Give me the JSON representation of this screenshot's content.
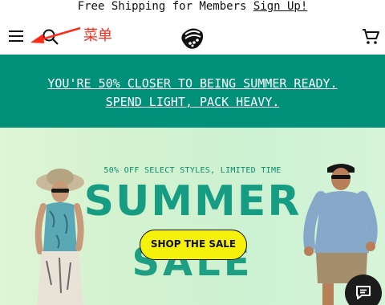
{
  "announcement": {
    "text": "Free Shipping for Members ",
    "link": "Sign Up!"
  },
  "header": {
    "menu_icon": "hamburger-menu-icon",
    "search_icon": "search-icon",
    "annotation_label": "菜单",
    "logo": "mountain-hardwear-logo",
    "cart_icon": "shopping-cart-icon"
  },
  "promo": {
    "line1": "YOU'RE 50% CLOSER TO BEING SUMMER READY.",
    "line2": "SPEND LIGHT, PACK HEAVY."
  },
  "hero": {
    "subtitle": "50% OFF SELECT STYLES, LIMITED TIME",
    "title": "SUMMER",
    "title2": "SALE",
    "cta": "SHOP THE SALE"
  },
  "chat": {
    "icon": "chat-icon"
  },
  "colors": {
    "promo_bg": "#00907a",
    "cta_bg": "#f5f10a",
    "hero_text": "#169c82",
    "annotation": "#ff2a1a"
  }
}
